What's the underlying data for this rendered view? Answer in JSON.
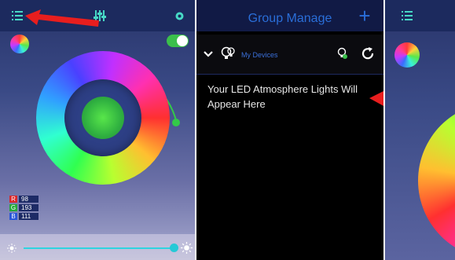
{
  "left_panel": {
    "topbar_icons": [
      "list-icon",
      "sliders-icon",
      "settings-icon"
    ],
    "toggle_on": true,
    "rgb": {
      "r_label": "R",
      "r": "98",
      "g_label": "G",
      "g": "193",
      "b_label": "B",
      "b": "111"
    },
    "brightness_level": 0.97
  },
  "middle_panel": {
    "title": "Group Manage",
    "add_icon": "+",
    "devices_label": "My Devices",
    "placeholder": "Your LED Atmosphere Lights Will Appear Here"
  },
  "right_panel": {
    "topbar_icons": [
      "list-icon"
    ]
  },
  "colors": {
    "accent": "#2a6ed8",
    "toggle": "#3bbf4b",
    "slider": "#2fd4e0",
    "arrow": "#e81e1e"
  }
}
